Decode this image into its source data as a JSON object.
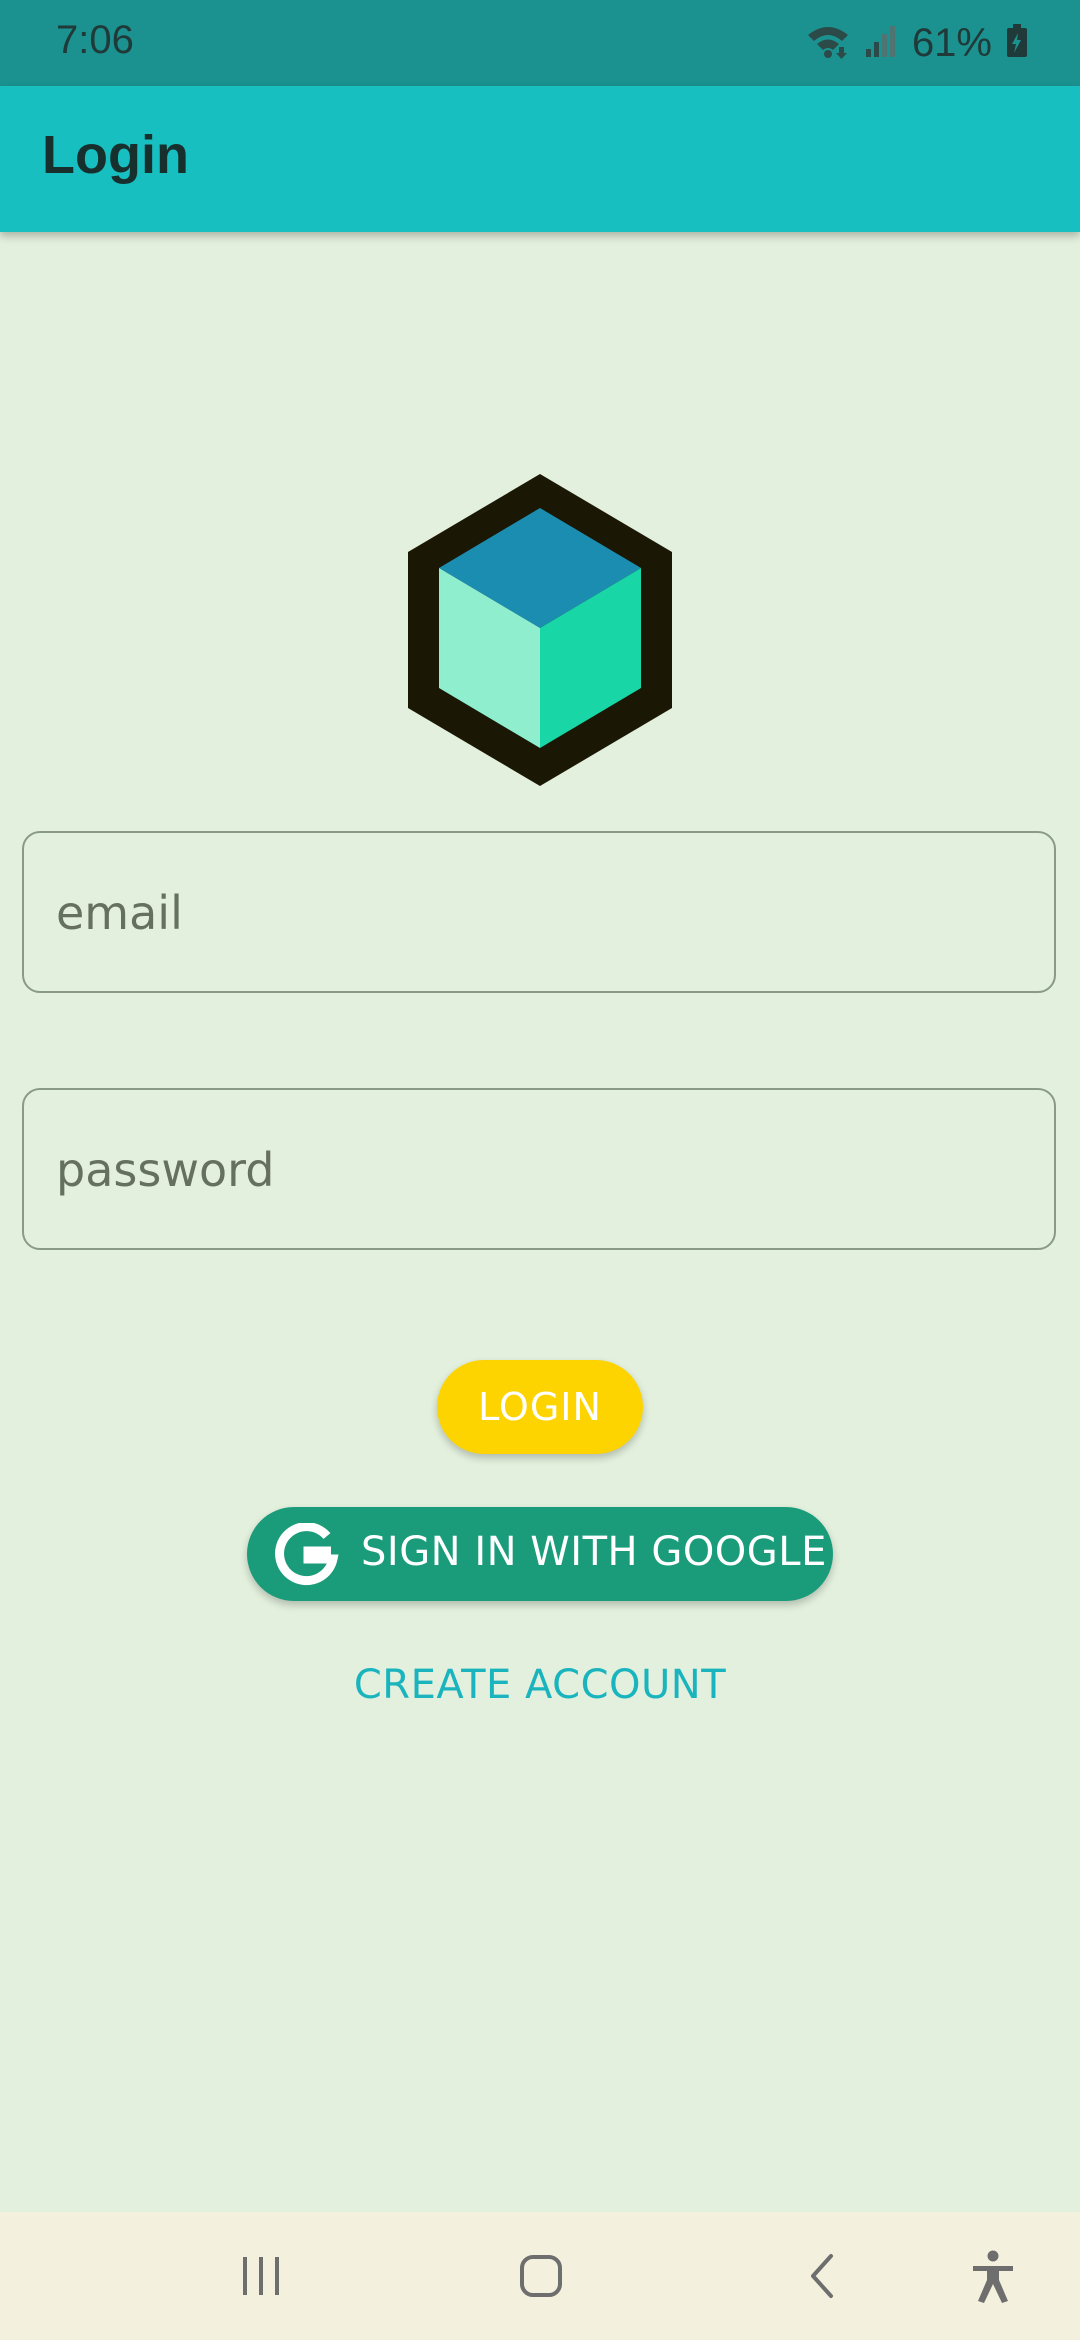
{
  "status_bar": {
    "time": "7:06",
    "battery_percent": "61%",
    "icons": [
      "wifi-icon",
      "signal-icon",
      "battery-charging-icon"
    ]
  },
  "app_bar": {
    "title": "Login"
  },
  "logo": {
    "icon": "cube-logo-icon",
    "colors": {
      "outline": "#1a1705",
      "top": "#1b8db1",
      "left": "#8eeece",
      "right": "#19d6a6"
    }
  },
  "form": {
    "email_placeholder": "email",
    "password_placeholder": "password",
    "login_label": "LOGIN",
    "google_label": "SIGN IN WITH GOOGLE",
    "create_account_label": "CREATE ACCOUNT"
  },
  "colors": {
    "status_bar": "#1b9290",
    "app_bar": "#18bfc1",
    "background": "#e3f0dd",
    "login_button": "#fdd400",
    "google_button": "#1a9c7b",
    "link": "#1ab4bf",
    "nav_bar": "#f3f1dd"
  },
  "nav_bar": {
    "buttons": [
      "recents-icon",
      "home-icon",
      "back-icon",
      "accessibility-icon"
    ]
  }
}
